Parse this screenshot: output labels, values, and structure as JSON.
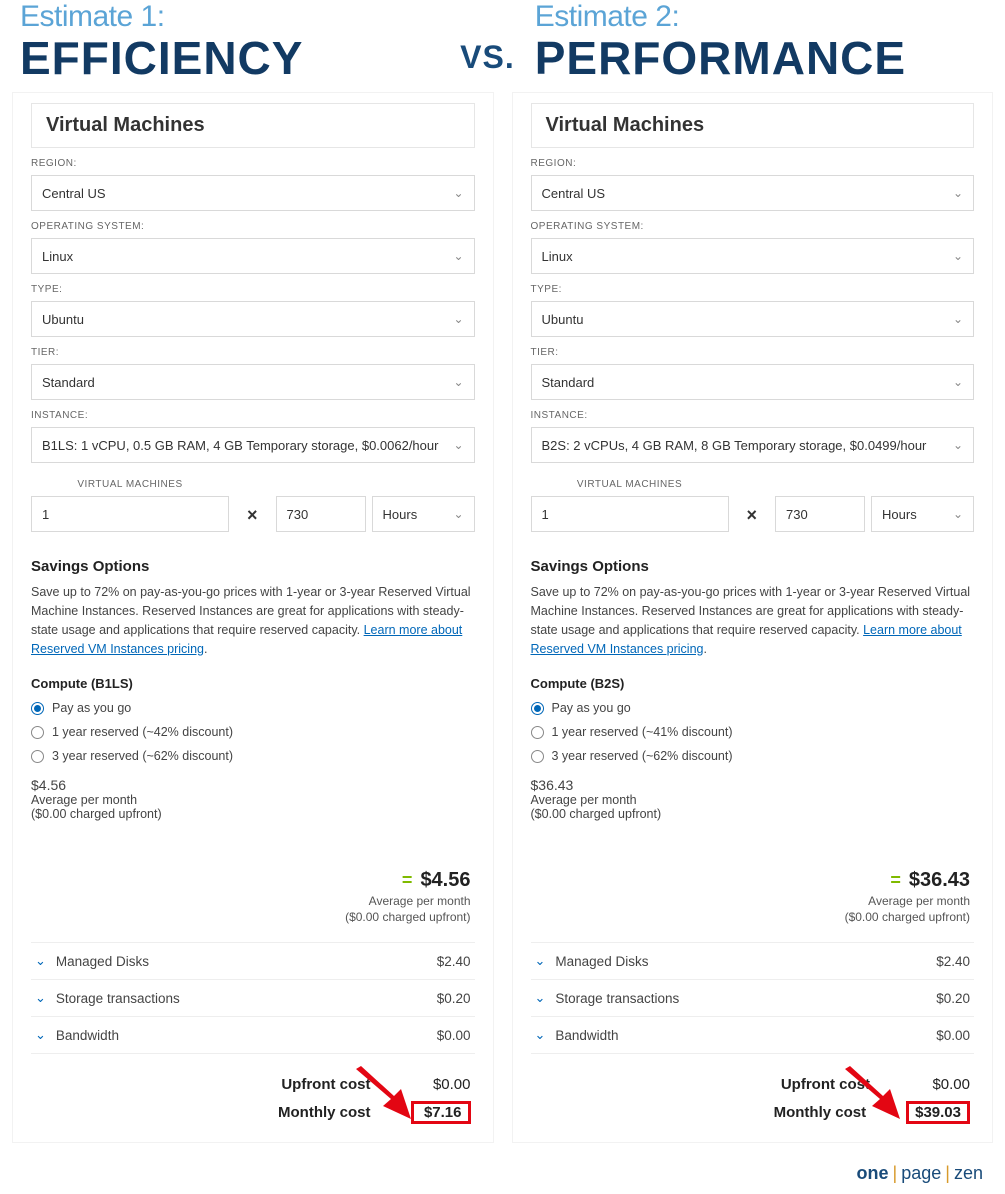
{
  "header": {
    "est1_label": "Estimate 1:",
    "est1_title": "EFFICIENCY",
    "vs": "VS.",
    "est2_label": "Estimate 2:",
    "est2_title": "PERFORMANCE"
  },
  "common": {
    "section_title": "Virtual Machines",
    "labels": {
      "region": "REGION:",
      "os": "OPERATING SYSTEM:",
      "type": "TYPE:",
      "tier": "TIER:",
      "instance": "INSTANCE:",
      "vm_count": "VIRTUAL MACHINES",
      "hours_unit": "Hours"
    },
    "savings_h": "Savings Options",
    "savings_p_pre": "Save up to 72% on pay-as-you-go prices with 1-year or 3-year Reserved Virtual Machine Instances. Reserved Instances are great for applications with steady-state usage and applications that require reserved capacity. ",
    "savings_link": "Learn more about Reserved VM Instances pricing",
    "avg_label": "Average per month",
    "upfront_label": "($0.00 charged upfront)",
    "line_disks": "Managed Disks",
    "line_storage": "Storage transactions",
    "line_bw": "Bandwidth",
    "tot_upfront": "Upfront cost",
    "tot_monthly": "Monthly cost",
    "times": "×"
  },
  "left": {
    "region": "Central US",
    "os": "Linux",
    "type": "Ubuntu",
    "tier": "Standard",
    "instance": "B1LS: 1 vCPU, 0.5 GB RAM, 4 GB Temporary storage, $0.0062/hour",
    "vm_count": "1",
    "hours": "730",
    "compute_h": "Compute (B1LS)",
    "opt1": "Pay as you go",
    "opt2": "1 year reserved (~42% discount)",
    "opt3": "3 year reserved (~62% discount)",
    "avg_amount": "$4.56",
    "sum_amount": "$4.56",
    "li_disks_v": "$2.40",
    "li_storage_v": "$0.20",
    "li_bw_v": "$0.00",
    "upfront_v": "$0.00",
    "monthly_v": "$7.16"
  },
  "right": {
    "region": "Central US",
    "os": "Linux",
    "type": "Ubuntu",
    "tier": "Standard",
    "instance": "B2S: 2 vCPUs, 4 GB RAM, 8 GB Temporary storage, $0.0499/hour",
    "vm_count": "1",
    "hours": "730",
    "compute_h": "Compute (B2S)",
    "opt1": "Pay as you go",
    "opt2": "1 year reserved (~41% discount)",
    "opt3": "3 year reserved (~62% discount)",
    "avg_amount": "$36.43",
    "sum_amount": "$36.43",
    "li_disks_v": "$2.40",
    "li_storage_v": "$0.20",
    "li_bw_v": "$0.00",
    "upfront_v": "$0.00",
    "monthly_v": "$39.03"
  },
  "footer": {
    "w1": "one",
    "w2": "page",
    "w3": "zen"
  }
}
